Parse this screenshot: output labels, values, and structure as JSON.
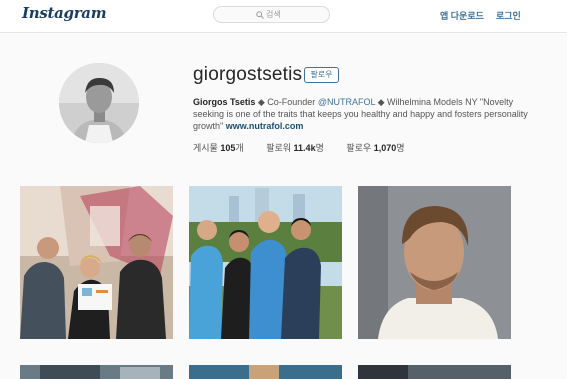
{
  "header": {
    "logo": "Instagram",
    "search": {
      "placeholder": "검색",
      "icon": "search-icon"
    },
    "nav": {
      "download": "앱 다운로드",
      "login": "로그인"
    }
  },
  "profile": {
    "username": "giorgostsetis",
    "follow_label": "팔로우",
    "bio": {
      "name": "Giorgos Tsetis",
      "text_1": " ◆ Co-Founder ",
      "mention": "@NUTRAFOL",
      "text_2": " ◆ Wilhelmina Models NY \"Novelty seeking is one of the traits that keeps you healthy and happy and fosters personality growth\" ",
      "link": "www.nutrafol.com"
    },
    "stats": {
      "posts_label": "게시물",
      "posts_value": "105",
      "posts_unit": "개",
      "followers_label": "팔로워",
      "followers_value": "11.4k",
      "followers_unit": "명",
      "following_label": "팔로우",
      "following_value": "1,070",
      "following_unit": "명"
    }
  },
  "colors": {
    "link": "#3f729b",
    "topbar": "#ffffff",
    "background": "#fafafa"
  }
}
